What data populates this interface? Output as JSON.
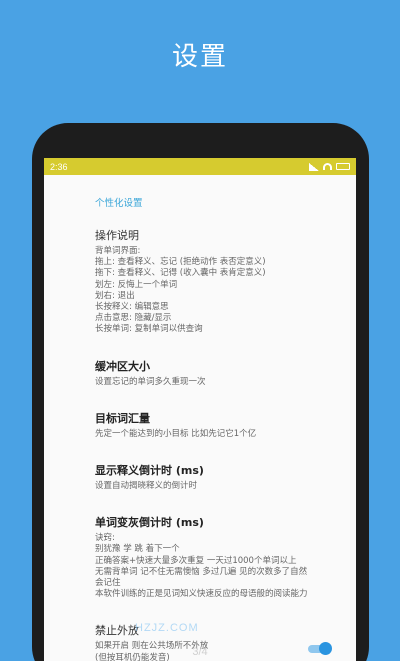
{
  "banner": {
    "title": "设置"
  },
  "statusbar": {
    "time": "2:36"
  },
  "settings": {
    "section_header": "个性化设置",
    "items": [
      {
        "title": "操作说明",
        "lines": [
          "背单词界面:",
          "拖上: 查看释义、忘记 (拒绝动作 表否定意义)",
          "拖下: 查看释义、记得 (收入囊中 表肯定意义)",
          "划左: 反悔上一个单词",
          "划右: 退出",
          "长按释义: 编辑意思",
          "点击意思: 隐藏/显示",
          "长按单词: 复制单词以供查询"
        ]
      },
      {
        "title": "缓冲区大小",
        "lines": [
          "设置忘记的单词多久重现一次"
        ]
      },
      {
        "title": "目标词汇量",
        "lines": [
          "先定一个能达到的小目标 比如先记它1个亿"
        ]
      },
      {
        "title": "显示释义倒计时 (ms)",
        "lines": [
          "设置自动揭晓释义的倒计时"
        ]
      },
      {
        "title": "单词变灰倒计时 (ms)",
        "lines": [
          "诀窍:",
          "别犹豫 学 跳 着下一个",
          "正确答案+快速大量多次重复 一天过1000个单词以上",
          "无需背单词 记不住无需懊恼 多过几遍 见的次数多了自然",
          "会记住",
          "本软件训练的正是见词知义快速反应的母语般的阅读能力"
        ]
      },
      {
        "title": "禁止外放",
        "lines": [
          "如果开启 则在公共场所不外放",
          "(但按耳机仍能发音)"
        ],
        "toggle_on": true
      }
    ]
  },
  "watermark": "HZJZ.COM",
  "pager": {
    "indicator": "3/4"
  },
  "colors": {
    "background": "#4aa2e4",
    "accent": "#3aa6d8",
    "statusbar": "#d6cb2f"
  }
}
